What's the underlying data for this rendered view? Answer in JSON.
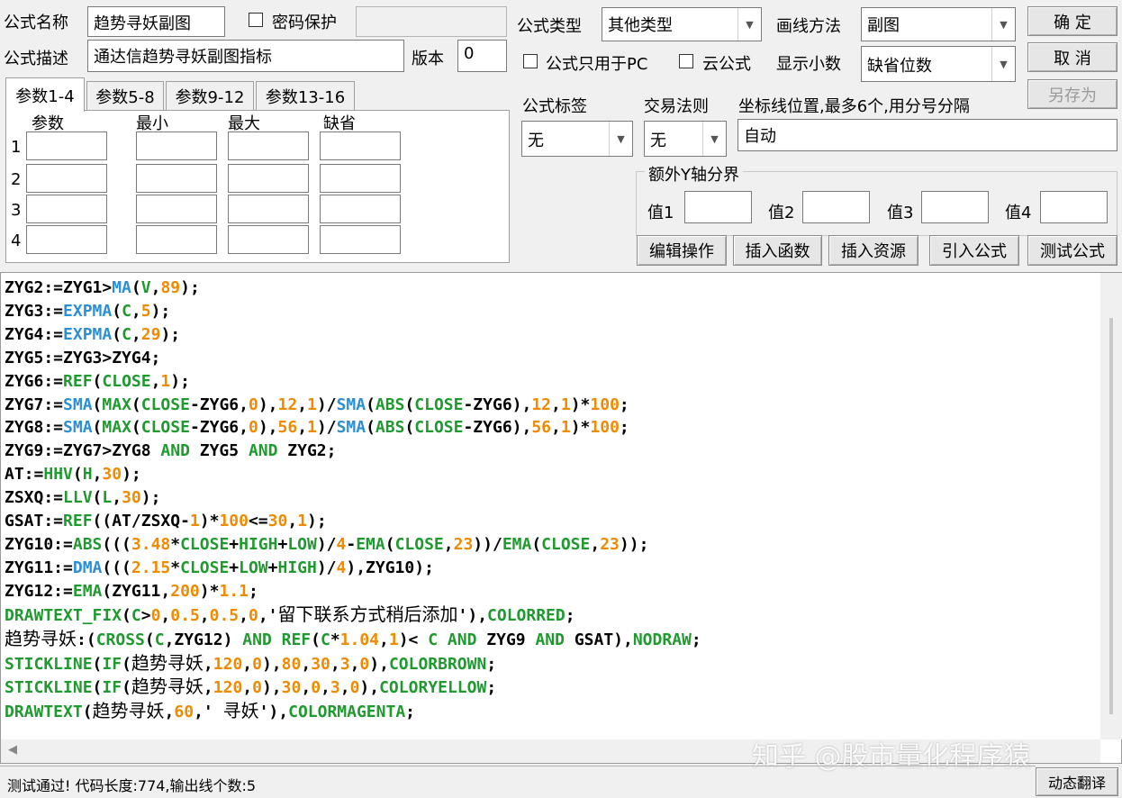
{
  "header": {
    "name_label": "公式名称",
    "name_value": "趋势寻妖副图",
    "password_label": "密码保护",
    "desc_label": "公式描述",
    "desc_value": "通达信趋势寻妖副图指标",
    "version_label": "版本",
    "version_value": "0",
    "type_label": "公式类型",
    "type_value": "其他类型",
    "draw_label": "画线方法",
    "draw_value": "副图",
    "pc_only_label": "公式只用于PC",
    "cloud_label": "云公式",
    "decimals_label": "显示小数",
    "decimals_value": "缺省位数"
  },
  "buttons": {
    "ok": "确 定",
    "cancel": "取 消",
    "save_as": "另存为",
    "edit_ops": "编辑操作",
    "insert_func": "插入函数",
    "insert_res": "插入资源",
    "import_formula": "引入公式",
    "test_formula": "测试公式",
    "dyn_translate": "动态翻译"
  },
  "tabs": [
    "参数1-4",
    "参数5-8",
    "参数9-12",
    "参数13-16"
  ],
  "params": {
    "col_param": "参数",
    "col_min": "最小",
    "col_max": "最大",
    "col_default": "缺省",
    "rows": [
      "1",
      "2",
      "3",
      "4"
    ]
  },
  "right": {
    "tag_label": "公式标签",
    "tag_value": "无",
    "rule_label": "交易法则",
    "rule_value": "无",
    "coord_label": "坐标线位置,最多6个,用分号分隔",
    "coord_value": "自动",
    "yaxis_label": "额外Y轴分界",
    "v1": "值1",
    "v2": "值2",
    "v3": "值3",
    "v4": "值4"
  },
  "code_tokens": [
    [
      [
        "d",
        "ZYG2:=ZYG1>"
      ],
      [
        "f",
        "MA"
      ],
      [
        "d",
        "("
      ],
      [
        "g",
        "V"
      ],
      [
        "d",
        ","
      ],
      [
        "n",
        "89"
      ],
      [
        "d",
        ");"
      ]
    ],
    [
      [
        "d",
        "ZYG3:="
      ],
      [
        "f",
        "EXPMA"
      ],
      [
        "d",
        "("
      ],
      [
        "g",
        "C"
      ],
      [
        "d",
        ","
      ],
      [
        "n",
        "5"
      ],
      [
        "d",
        ");"
      ]
    ],
    [
      [
        "d",
        "ZYG4:="
      ],
      [
        "f",
        "EXPMA"
      ],
      [
        "d",
        "("
      ],
      [
        "g",
        "C"
      ],
      [
        "d",
        ","
      ],
      [
        "n",
        "29"
      ],
      [
        "d",
        ");"
      ]
    ],
    [
      [
        "d",
        "ZYG5:=ZYG3>ZYG4;"
      ]
    ],
    [
      [
        "d",
        "ZYG6:="
      ],
      [
        "g",
        "REF"
      ],
      [
        "d",
        "("
      ],
      [
        "g",
        "CLOSE"
      ],
      [
        "d",
        ","
      ],
      [
        "n",
        "1"
      ],
      [
        "d",
        ");"
      ]
    ],
    [
      [
        "d",
        "ZYG7:="
      ],
      [
        "f",
        "SMA"
      ],
      [
        "d",
        "("
      ],
      [
        "g",
        "MAX"
      ],
      [
        "d",
        "("
      ],
      [
        "g",
        "CLOSE"
      ],
      [
        "d",
        "-ZYG6,"
      ],
      [
        "n",
        "0"
      ],
      [
        "d",
        "),"
      ],
      [
        "n",
        "12"
      ],
      [
        "d",
        ","
      ],
      [
        "n",
        "1"
      ],
      [
        "d",
        ")/"
      ],
      [
        "f",
        "SMA"
      ],
      [
        "d",
        "("
      ],
      [
        "g",
        "ABS"
      ],
      [
        "d",
        "("
      ],
      [
        "g",
        "CLOSE"
      ],
      [
        "d",
        "-ZYG6),"
      ],
      [
        "n",
        "12"
      ],
      [
        "d",
        ","
      ],
      [
        "n",
        "1"
      ],
      [
        "d",
        ")*"
      ],
      [
        "n",
        "100"
      ],
      [
        "d",
        ";"
      ]
    ],
    [
      [
        "d",
        "ZYG8:="
      ],
      [
        "f",
        "SMA"
      ],
      [
        "d",
        "("
      ],
      [
        "g",
        "MAX"
      ],
      [
        "d",
        "("
      ],
      [
        "g",
        "CLOSE"
      ],
      [
        "d",
        "-ZYG6,"
      ],
      [
        "n",
        "0"
      ],
      [
        "d",
        "),"
      ],
      [
        "n",
        "56"
      ],
      [
        "d",
        ","
      ],
      [
        "n",
        "1"
      ],
      [
        "d",
        ")/"
      ],
      [
        "f",
        "SMA"
      ],
      [
        "d",
        "("
      ],
      [
        "g",
        "ABS"
      ],
      [
        "d",
        "("
      ],
      [
        "g",
        "CLOSE"
      ],
      [
        "d",
        "-ZYG6),"
      ],
      [
        "n",
        "56"
      ],
      [
        "d",
        ","
      ],
      [
        "n",
        "1"
      ],
      [
        "d",
        ")*"
      ],
      [
        "n",
        "100"
      ],
      [
        "d",
        ";"
      ]
    ],
    [
      [
        "d",
        "ZYG9:=ZYG7>ZYG8 "
      ],
      [
        "g",
        "AND"
      ],
      [
        "d",
        " ZYG5 "
      ],
      [
        "g",
        "AND"
      ],
      [
        "d",
        " ZYG2;"
      ]
    ],
    [
      [
        "d",
        "AT:="
      ],
      [
        "g",
        "HHV"
      ],
      [
        "d",
        "("
      ],
      [
        "g",
        "H"
      ],
      [
        "d",
        ","
      ],
      [
        "n",
        "30"
      ],
      [
        "d",
        ");"
      ]
    ],
    [
      [
        "d",
        "ZSXQ:="
      ],
      [
        "g",
        "LLV"
      ],
      [
        "d",
        "("
      ],
      [
        "g",
        "L"
      ],
      [
        "d",
        ","
      ],
      [
        "n",
        "30"
      ],
      [
        "d",
        ");"
      ]
    ],
    [
      [
        "d",
        "GSAT:="
      ],
      [
        "g",
        "REF"
      ],
      [
        "d",
        "((AT/ZSXQ-"
      ],
      [
        "n",
        "1"
      ],
      [
        "d",
        ")*"
      ],
      [
        "n",
        "100"
      ],
      [
        "d",
        "<="
      ],
      [
        "n",
        "30"
      ],
      [
        "d",
        ","
      ],
      [
        "n",
        "1"
      ],
      [
        "d",
        ");"
      ]
    ],
    [
      [
        "d",
        "ZYG10:="
      ],
      [
        "g",
        "ABS"
      ],
      [
        "d",
        "((("
      ],
      [
        "n",
        "3.48"
      ],
      [
        "d",
        "*"
      ],
      [
        "g",
        "CLOSE"
      ],
      [
        "d",
        "+"
      ],
      [
        "g",
        "HIGH"
      ],
      [
        "d",
        "+"
      ],
      [
        "g",
        "LOW"
      ],
      [
        "d",
        ")/"
      ],
      [
        "n",
        "4"
      ],
      [
        "d",
        "-"
      ],
      [
        "g",
        "EMA"
      ],
      [
        "d",
        "("
      ],
      [
        "g",
        "CLOSE"
      ],
      [
        "d",
        ","
      ],
      [
        "n",
        "23"
      ],
      [
        "d",
        "))/"
      ],
      [
        "g",
        "EMA"
      ],
      [
        "d",
        "("
      ],
      [
        "g",
        "CLOSE"
      ],
      [
        "d",
        ","
      ],
      [
        "n",
        "23"
      ],
      [
        "d",
        "));"
      ]
    ],
    [
      [
        "d",
        "ZYG11:="
      ],
      [
        "f",
        "DMA"
      ],
      [
        "d",
        "((("
      ],
      [
        "n",
        "2.15"
      ],
      [
        "d",
        "*"
      ],
      [
        "g",
        "CLOSE"
      ],
      [
        "d",
        "+"
      ],
      [
        "g",
        "LOW"
      ],
      [
        "d",
        "+"
      ],
      [
        "g",
        "HIGH"
      ],
      [
        "d",
        ")/"
      ],
      [
        "n",
        "4"
      ],
      [
        "d",
        "),ZYG10);"
      ]
    ],
    [
      [
        "d",
        "ZYG12:="
      ],
      [
        "g",
        "EMA"
      ],
      [
        "d",
        "(ZYG11,"
      ],
      [
        "n",
        "200"
      ],
      [
        "d",
        ")*"
      ],
      [
        "n",
        "1.1"
      ],
      [
        "d",
        ";"
      ]
    ],
    [
      [
        "g",
        "DRAWTEXT_FIX"
      ],
      [
        "d",
        "("
      ],
      [
        "g",
        "C"
      ],
      [
        "d",
        ">"
      ],
      [
        "n",
        "0"
      ],
      [
        "d",
        ","
      ],
      [
        "n",
        "0.5"
      ],
      [
        "d",
        ","
      ],
      [
        "n",
        "0.5"
      ],
      [
        "d",
        ","
      ],
      [
        "n",
        "0"
      ],
      [
        "d",
        ",'"
      ],
      [
        "c",
        "留下联系方式稍后添加"
      ],
      [
        "d",
        "'),"
      ],
      [
        "g",
        "COLORRED"
      ],
      [
        "d",
        ";"
      ]
    ],
    [
      [
        "c",
        "趋势寻妖"
      ],
      [
        "d",
        ":("
      ],
      [
        "g",
        "CROSS"
      ],
      [
        "d",
        "("
      ],
      [
        "g",
        "C"
      ],
      [
        "d",
        ",ZYG12) "
      ],
      [
        "g",
        "AND"
      ],
      [
        "d",
        " "
      ],
      [
        "g",
        "REF"
      ],
      [
        "d",
        "("
      ],
      [
        "g",
        "C"
      ],
      [
        "d",
        "*"
      ],
      [
        "n",
        "1.04"
      ],
      [
        "d",
        ","
      ],
      [
        "n",
        "1"
      ],
      [
        "d",
        ")< "
      ],
      [
        "g",
        "C"
      ],
      [
        "d",
        " "
      ],
      [
        "g",
        "AND"
      ],
      [
        "d",
        " ZYG9 "
      ],
      [
        "g",
        "AND"
      ],
      [
        "d",
        " GSAT),"
      ],
      [
        "g",
        "NODRAW"
      ],
      [
        "d",
        ";"
      ]
    ],
    [
      [
        "g",
        "STICKLINE"
      ],
      [
        "d",
        "("
      ],
      [
        "g",
        "IF"
      ],
      [
        "d",
        "("
      ],
      [
        "c",
        "趋势寻妖"
      ],
      [
        "d",
        ","
      ],
      [
        "n",
        "120"
      ],
      [
        "d",
        ","
      ],
      [
        "n",
        "0"
      ],
      [
        "d",
        "),"
      ],
      [
        "n",
        "80"
      ],
      [
        "d",
        ","
      ],
      [
        "n",
        "30"
      ],
      [
        "d",
        ","
      ],
      [
        "n",
        "3"
      ],
      [
        "d",
        ","
      ],
      [
        "n",
        "0"
      ],
      [
        "d",
        "),"
      ],
      [
        "g",
        "COLORBROWN"
      ],
      [
        "d",
        ";"
      ]
    ],
    [
      [
        "g",
        "STICKLINE"
      ],
      [
        "d",
        "("
      ],
      [
        "g",
        "IF"
      ],
      [
        "d",
        "("
      ],
      [
        "c",
        "趋势寻妖"
      ],
      [
        "d",
        ","
      ],
      [
        "n",
        "120"
      ],
      [
        "d",
        ","
      ],
      [
        "n",
        "0"
      ],
      [
        "d",
        "),"
      ],
      [
        "n",
        "30"
      ],
      [
        "d",
        ","
      ],
      [
        "n",
        "0"
      ],
      [
        "d",
        ","
      ],
      [
        "n",
        "3"
      ],
      [
        "d",
        ","
      ],
      [
        "n",
        "0"
      ],
      [
        "d",
        "),"
      ],
      [
        "g",
        "COLORYELLOW"
      ],
      [
        "d",
        ";"
      ]
    ],
    [
      [
        "g",
        "DRAWTEXT"
      ],
      [
        "d",
        "("
      ],
      [
        "c",
        "趋势寻妖"
      ],
      [
        "d",
        ","
      ],
      [
        "n",
        "60"
      ],
      [
        "d",
        ",' "
      ],
      [
        "c",
        "寻妖"
      ],
      [
        "d",
        "'),"
      ],
      [
        "g",
        "COLORMAGENTA"
      ],
      [
        "d",
        ";"
      ]
    ]
  ],
  "status_text": "测试通过! 代码长度:774,输出线个数:5",
  "watermark": "知乎 @股市量化程序猿"
}
